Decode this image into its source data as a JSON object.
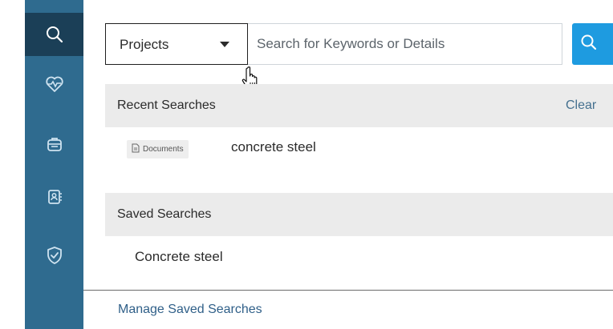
{
  "sidebar": {
    "items": [
      {
        "icon": "search-icon",
        "active": true
      },
      {
        "icon": "heart-pulse-icon",
        "active": false
      },
      {
        "icon": "briefcase-icon",
        "active": false
      },
      {
        "icon": "contact-book-icon",
        "active": false
      },
      {
        "icon": "shield-check-icon",
        "active": false
      }
    ],
    "colors": {
      "bar": "#2f6b8f",
      "active": "#1b3f57"
    }
  },
  "search": {
    "scope_label": "Projects",
    "placeholder": "Search for Keywords or Details",
    "value": "",
    "button_icon": "search-icon",
    "button_color": "#1e9be0"
  },
  "recent": {
    "title": "Recent Searches",
    "clear_label": "Clear",
    "items": [
      {
        "badge": "Documents",
        "badge_icon": "document-icon",
        "text": "concrete steel"
      }
    ]
  },
  "saved": {
    "title": "Saved Searches",
    "items": [
      {
        "text": "Concrete steel"
      }
    ]
  },
  "footer": {
    "manage_label": "Manage Saved Searches"
  }
}
